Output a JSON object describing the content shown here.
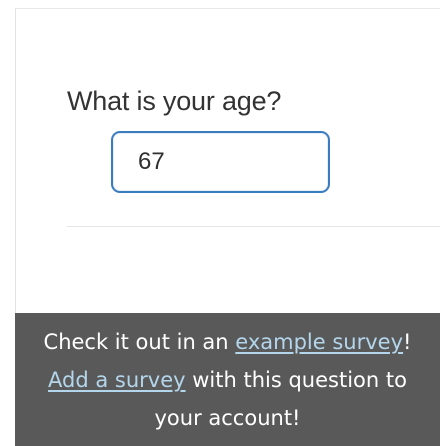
{
  "question": {
    "label": "What is your age?",
    "answer_value": "67"
  },
  "banner": {
    "line1_prefix": "Check it out in an ",
    "example_link": "example survey",
    "line1_suffix": "!",
    "add_link": "Add a survey",
    "line2_suffix": " with this question to",
    "line3": "your account!"
  },
  "colors": {
    "banner_bg": "#595959",
    "link": "#b4d6ec",
    "input_border": "#3a7cbf"
  }
}
